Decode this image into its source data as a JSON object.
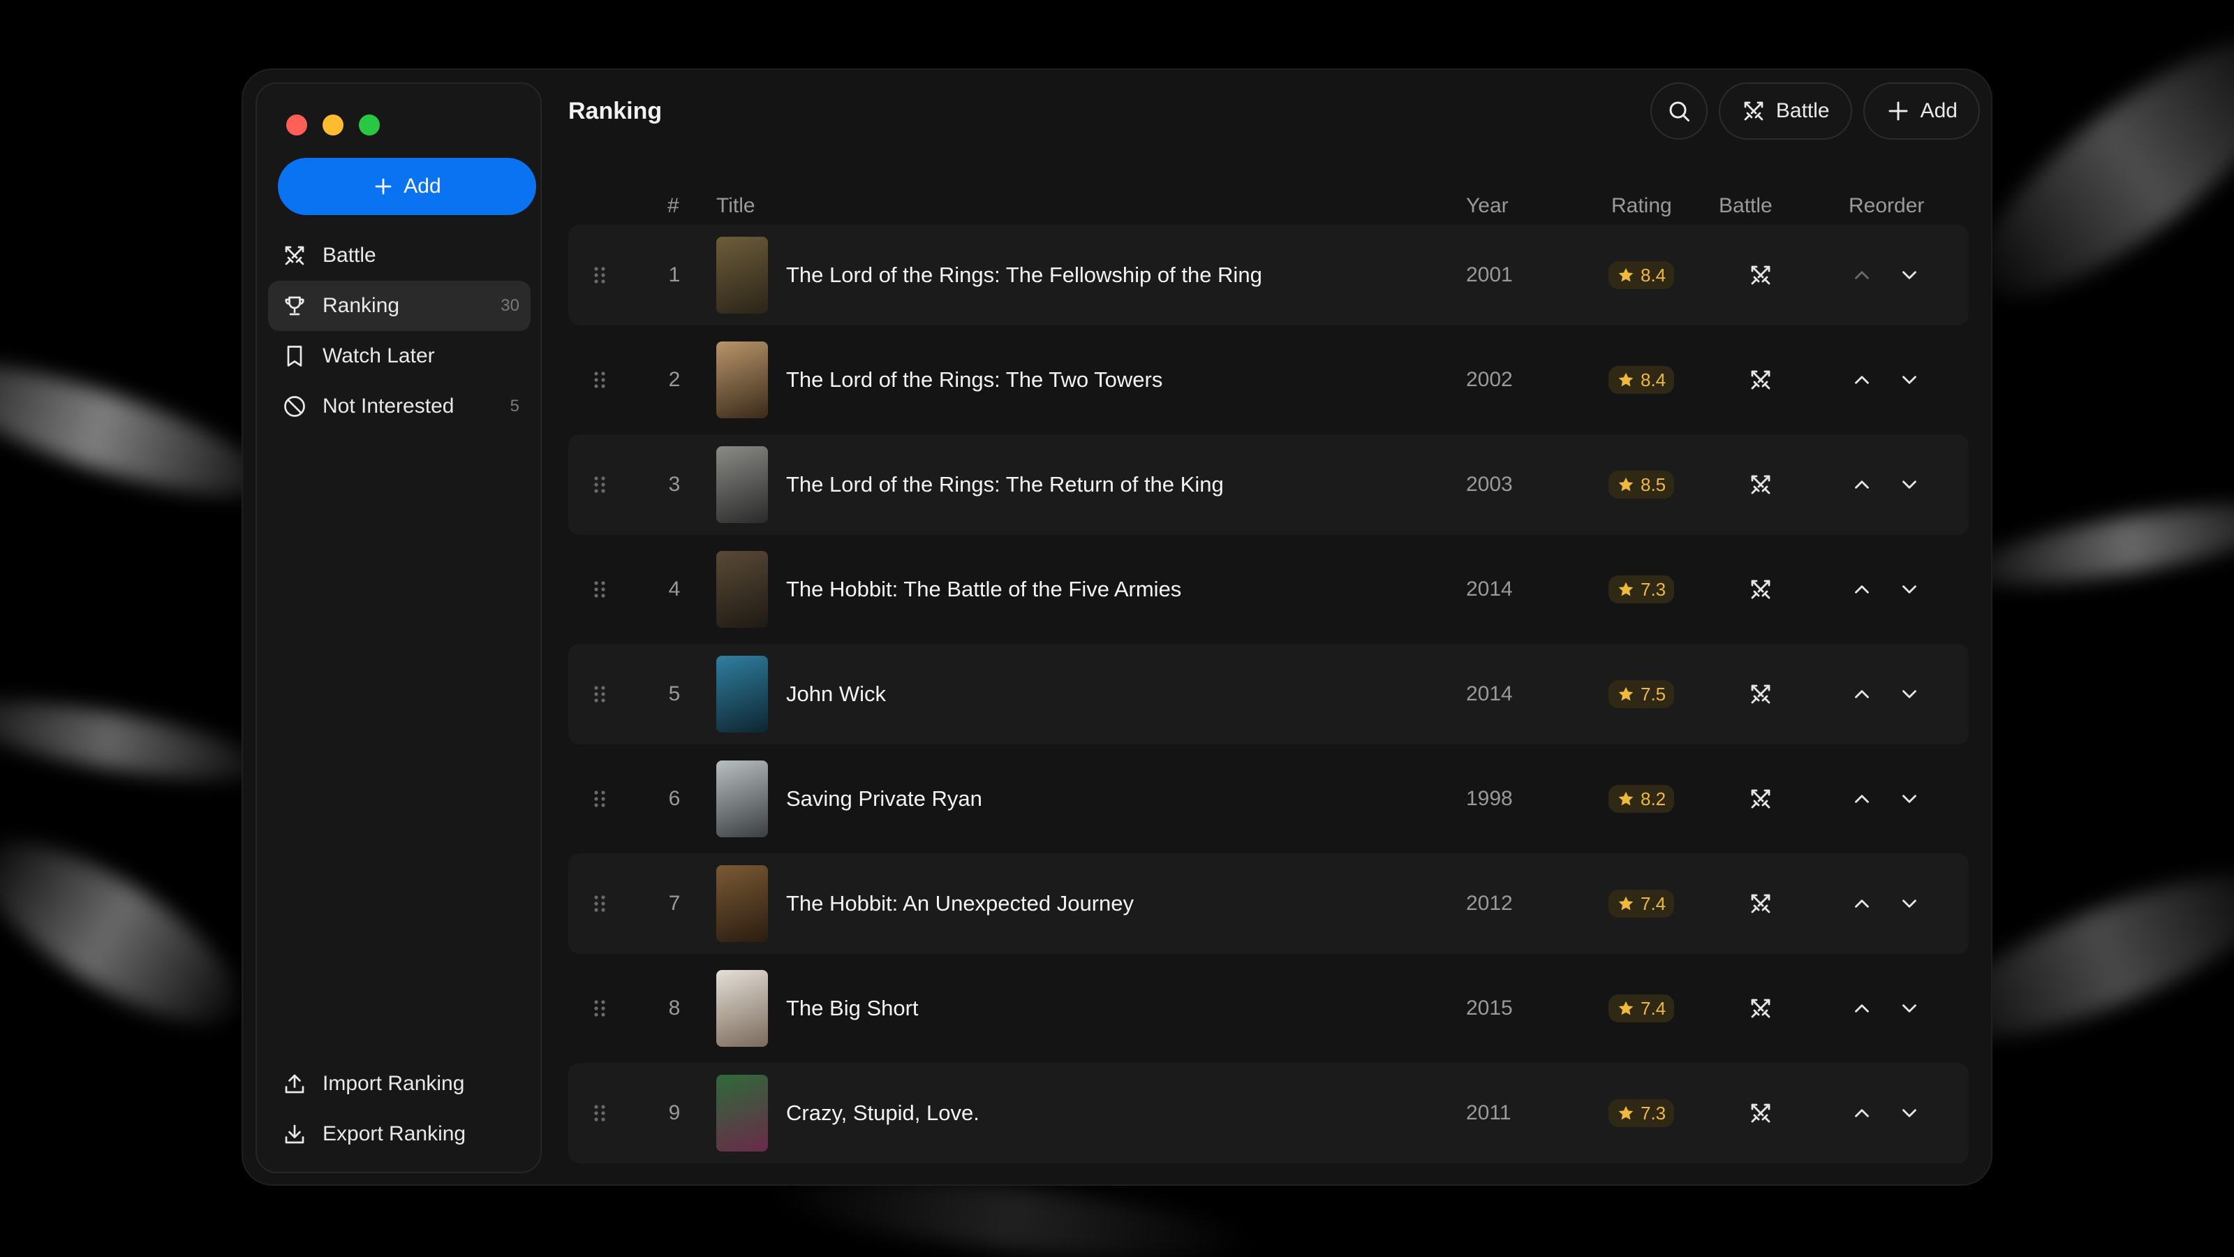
{
  "window": {
    "controls": [
      "close",
      "minimize",
      "maximize"
    ]
  },
  "sidebar": {
    "add_label": "Add",
    "items": [
      {
        "label": "Battle",
        "icon": "swords-icon",
        "count": ""
      },
      {
        "label": "Ranking",
        "icon": "trophy-icon",
        "count": "30"
      },
      {
        "label": "Watch Later",
        "icon": "bookmark-icon",
        "count": ""
      },
      {
        "label": "Not Interested",
        "icon": "ban-icon",
        "count": "5"
      }
    ],
    "footer": [
      {
        "label": "Import Ranking",
        "icon": "upload-icon"
      },
      {
        "label": "Export Ranking",
        "icon": "download-icon"
      }
    ]
  },
  "header": {
    "title": "Ranking",
    "search_icon": "search-icon",
    "battle_label": "Battle",
    "add_label": "Add"
  },
  "table": {
    "columns": {
      "num": "#",
      "title": "Title",
      "year": "Year",
      "rating": "Rating",
      "battle": "Battle",
      "reorder": "Reorder"
    },
    "rows": [
      {
        "rank": "1",
        "title": "The Lord of the Rings: The Fellowship of the Ring",
        "year": "2001",
        "rating": "8.4",
        "poster_colors": [
          "#6d5d3a",
          "#2b2418"
        ]
      },
      {
        "rank": "2",
        "title": "The Lord of the Rings: The Two Towers",
        "year": "2002",
        "rating": "8.4",
        "poster_colors": [
          "#b8956a",
          "#3a2a1a"
        ]
      },
      {
        "rank": "3",
        "title": "The Lord of the Rings: The Return of the King",
        "year": "2003",
        "rating": "8.5",
        "poster_colors": [
          "#8a8a86",
          "#2a2a2a"
        ]
      },
      {
        "rank": "4",
        "title": "The Hobbit: The Battle of the Five Armies",
        "year": "2014",
        "rating": "7.3",
        "poster_colors": [
          "#5a4a36",
          "#1e1a14"
        ]
      },
      {
        "rank": "5",
        "title": "John Wick",
        "year": "2014",
        "rating": "7.5",
        "poster_colors": [
          "#2f7fa0",
          "#0e2530"
        ]
      },
      {
        "rank": "6",
        "title": "Saving Private Ryan",
        "year": "1998",
        "rating": "8.2",
        "poster_colors": [
          "#b9c0c2",
          "#3a3e40"
        ]
      },
      {
        "rank": "7",
        "title": "The Hobbit: An Unexpected Journey",
        "year": "2012",
        "rating": "7.4",
        "poster_colors": [
          "#7a5a34",
          "#2a1c10"
        ]
      },
      {
        "rank": "8",
        "title": "The Big Short",
        "year": "2015",
        "rating": "7.4",
        "poster_colors": [
          "#e4e0d8",
          "#7a6a5a"
        ]
      },
      {
        "rank": "9",
        "title": "Crazy, Stupid, Love.",
        "year": "2011",
        "rating": "7.3",
        "poster_colors": [
          "#2f6a3a",
          "#6a2a4a"
        ]
      }
    ]
  },
  "colors": {
    "accent": "#0a73f2",
    "rating": "#f0b93b",
    "background": "#141414"
  }
}
